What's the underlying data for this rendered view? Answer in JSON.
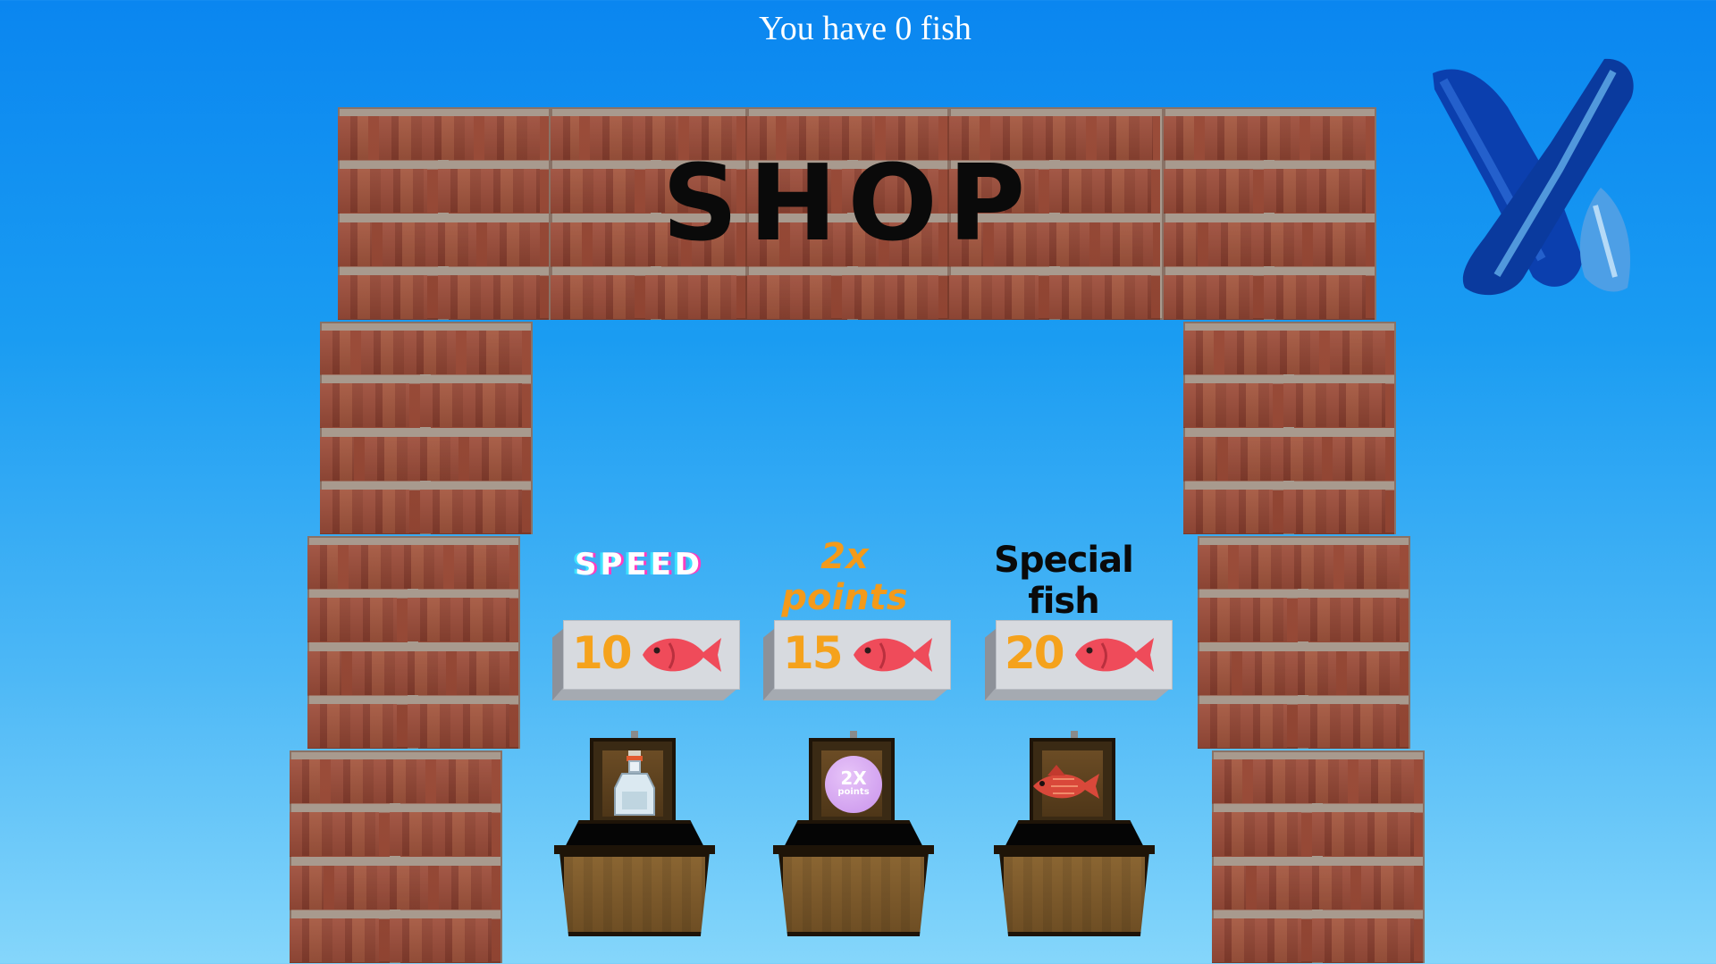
{
  "hud": {
    "fish_count_text": "You have 0 fish"
  },
  "shop": {
    "title": "SHOP"
  },
  "close": {
    "icon": "close-x-icon",
    "color": "#0b3fae"
  },
  "items": [
    {
      "label": "SPEED",
      "price": "10",
      "currency_icon": "fish-icon",
      "contents_icon": "potion-bottle-icon"
    },
    {
      "label": "2x points",
      "price": "15",
      "currency_icon": "fish-icon",
      "contents_icon": "2x-points-badge-icon",
      "badge_big": "2X",
      "badge_small": "points"
    },
    {
      "label": "Special fish",
      "price": "20",
      "currency_icon": "fish-icon",
      "contents_icon": "red-fish-icon"
    }
  ],
  "colors": {
    "sky_top": "#0a86f0",
    "sky_bottom": "#85d6fb",
    "brick": "#9b4d3a",
    "mortar": "#a89a8e",
    "price_text": "#f5a21c",
    "fish_icon": "#ef4b5a"
  }
}
